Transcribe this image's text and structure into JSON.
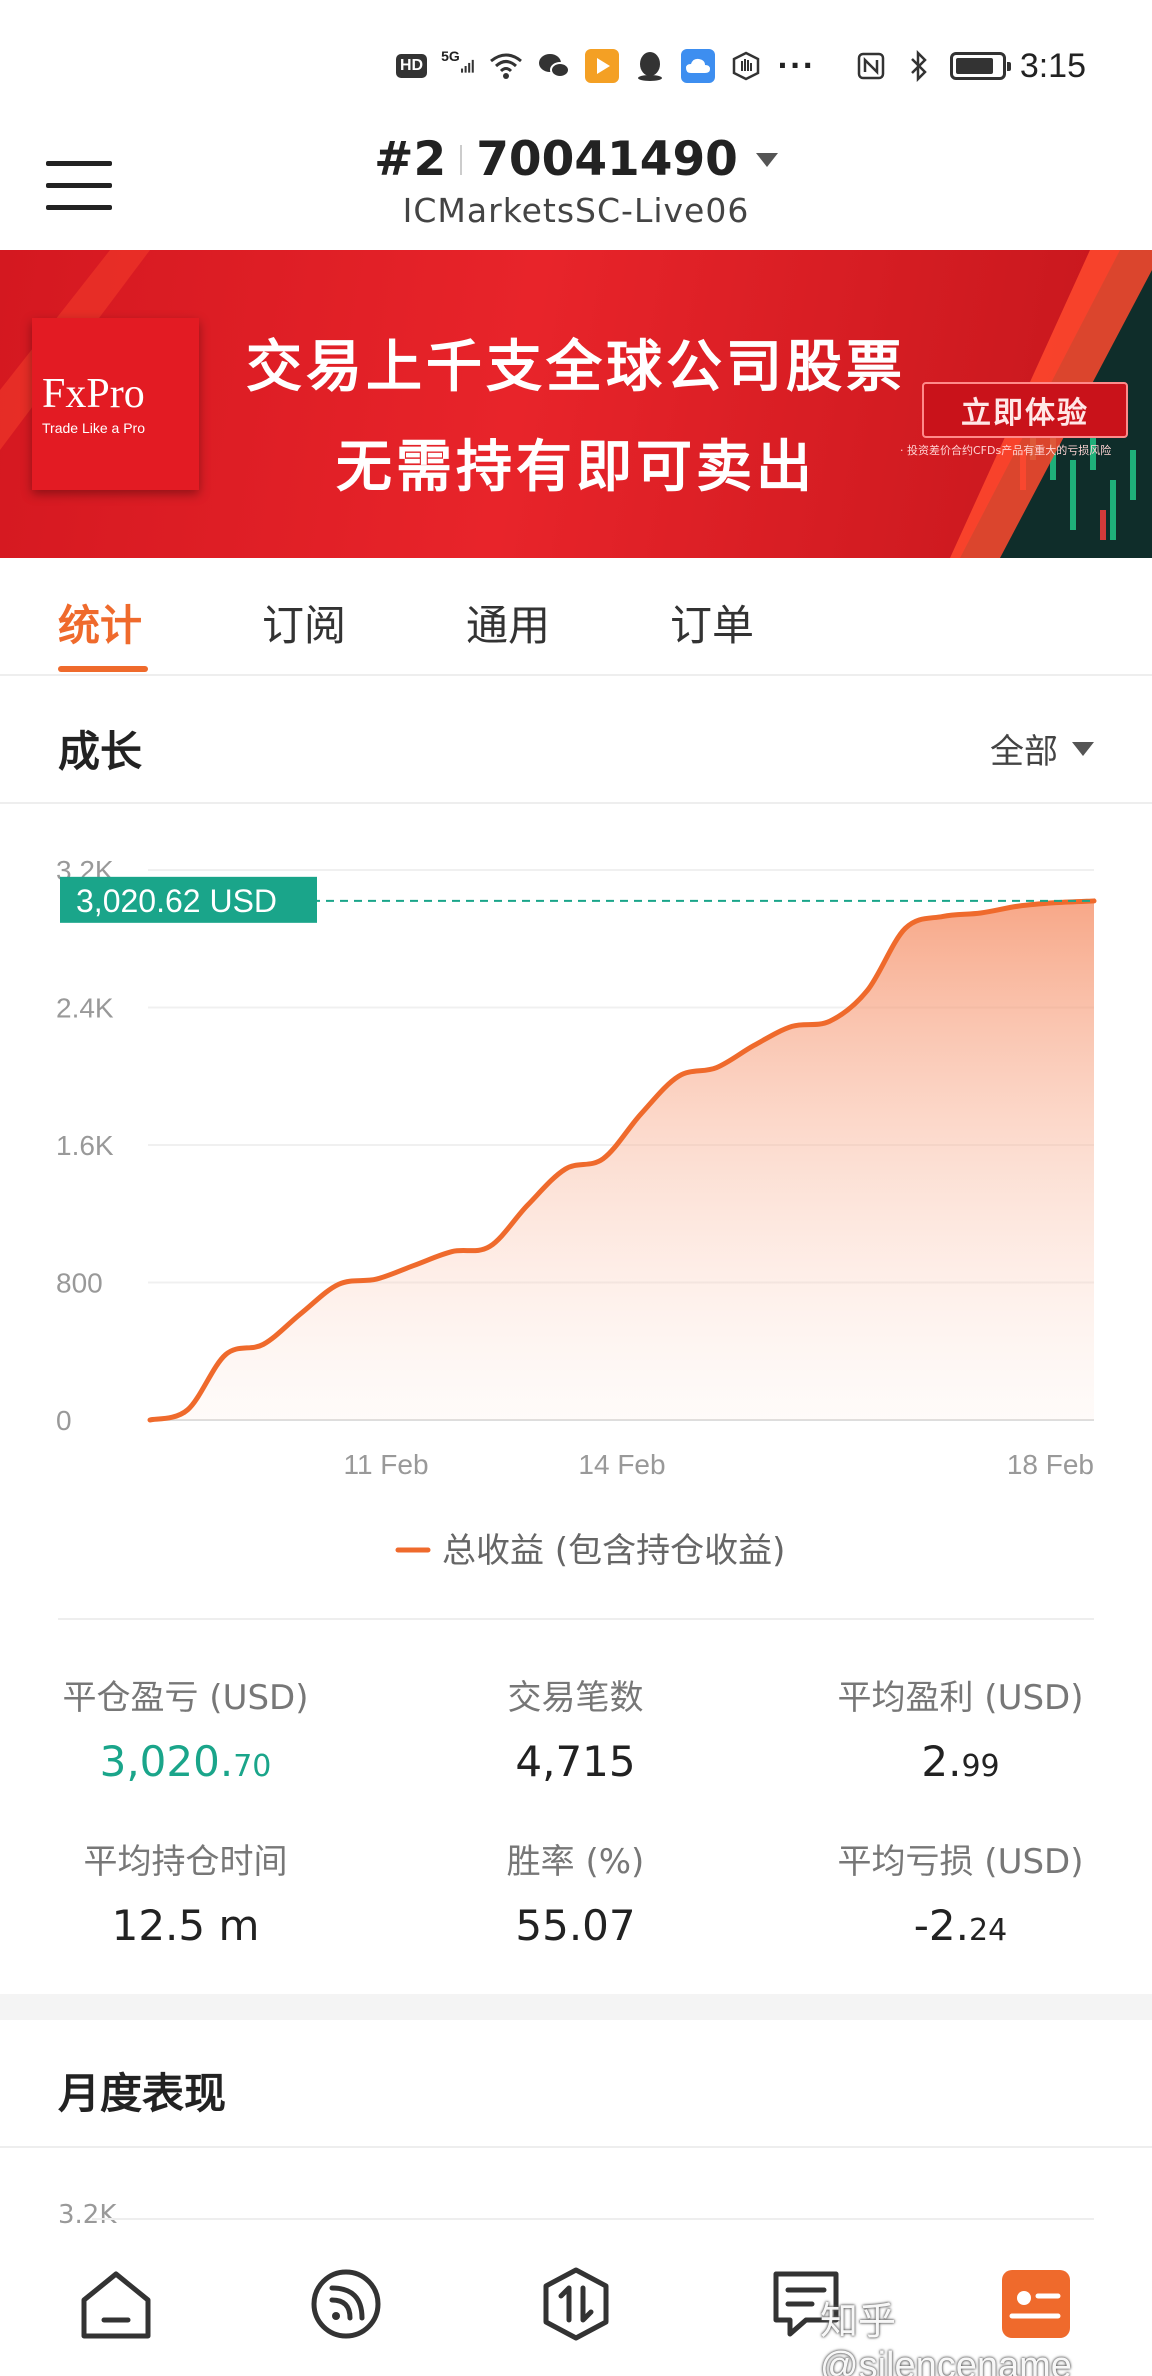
{
  "status_bar": {
    "hd": "HD",
    "network": "5G",
    "time": "3:15",
    "battery_level": 0.85
  },
  "header": {
    "account_index": "#2",
    "account_number": "70041490",
    "server": "ICMarketsSC-Live06"
  },
  "banner": {
    "brand": "FxPro",
    "tagline": "Trade Like a Pro",
    "line1": "交易上千支全球公司股票",
    "line2": "无需持有即可卖出",
    "cta": "立即体验",
    "disclaimer": "· 投资差价合约CFDs产品有重大的亏损风险"
  },
  "tabs": [
    {
      "label": "统计",
      "active": true
    },
    {
      "label": "订阅",
      "active": false
    },
    {
      "label": "通用",
      "active": false
    },
    {
      "label": "订单",
      "active": false
    }
  ],
  "growth": {
    "title": "成长",
    "filter": "全部",
    "current_label": "3,020.62 USD",
    "legend": "总收益 (包含持仓收益)"
  },
  "chart_data": {
    "type": "area",
    "ylim": [
      0,
      3200
    ],
    "yticks": [
      "0",
      "800",
      "1.6K",
      "2.4K",
      "3.2K"
    ],
    "ytick_values": [
      0,
      800,
      1600,
      2400,
      3200
    ],
    "xticks": [
      "11 Feb",
      "14 Feb",
      "18 Feb"
    ],
    "xtick_positions": [
      0.25,
      0.5,
      1.0
    ],
    "series": [
      {
        "name": "总收益 (包含持仓收益)",
        "x": [
          0,
          0.04,
          0.08,
          0.12,
          0.16,
          0.2,
          0.24,
          0.28,
          0.32,
          0.36,
          0.4,
          0.44,
          0.48,
          0.52,
          0.56,
          0.6,
          0.64,
          0.68,
          0.72,
          0.76,
          0.8,
          0.84,
          0.88,
          0.92,
          0.96,
          1.0
        ],
        "values": [
          0,
          60,
          380,
          440,
          620,
          790,
          820,
          900,
          980,
          1010,
          1250,
          1460,
          1520,
          1780,
          2000,
          2050,
          2180,
          2290,
          2320,
          2500,
          2860,
          2930,
          2950,
          2990,
          3010,
          3020
        ]
      }
    ],
    "highlight_value": 3020.62,
    "color": "#ef6a2c"
  },
  "stats": {
    "closed_pl": {
      "label": "平仓盈亏 (USD)",
      "int": "3,020.",
      "dec": "70"
    },
    "trades": {
      "label": "交易笔数",
      "value": "4,715"
    },
    "avg_profit": {
      "label": "平均盈利 (USD)",
      "int": "2.",
      "dec": "99"
    },
    "avg_hold": {
      "label": "平均持仓时间",
      "value": "12.5 m"
    },
    "win_rate": {
      "label": "胜率 (%)",
      "value": "55.07"
    },
    "avg_loss": {
      "label": "平均亏损 (USD)",
      "int": "-2.",
      "dec": "24"
    }
  },
  "monthly": {
    "title": "月度表现",
    "ytick_top": "3.2K"
  },
  "bottom_nav": [
    {
      "icon": "home-icon"
    },
    {
      "icon": "feed-icon"
    },
    {
      "icon": "trade-icon"
    },
    {
      "icon": "orders-icon"
    },
    {
      "icon": "profile-icon",
      "active": true
    }
  ],
  "watermark": "知乎 @silencename"
}
